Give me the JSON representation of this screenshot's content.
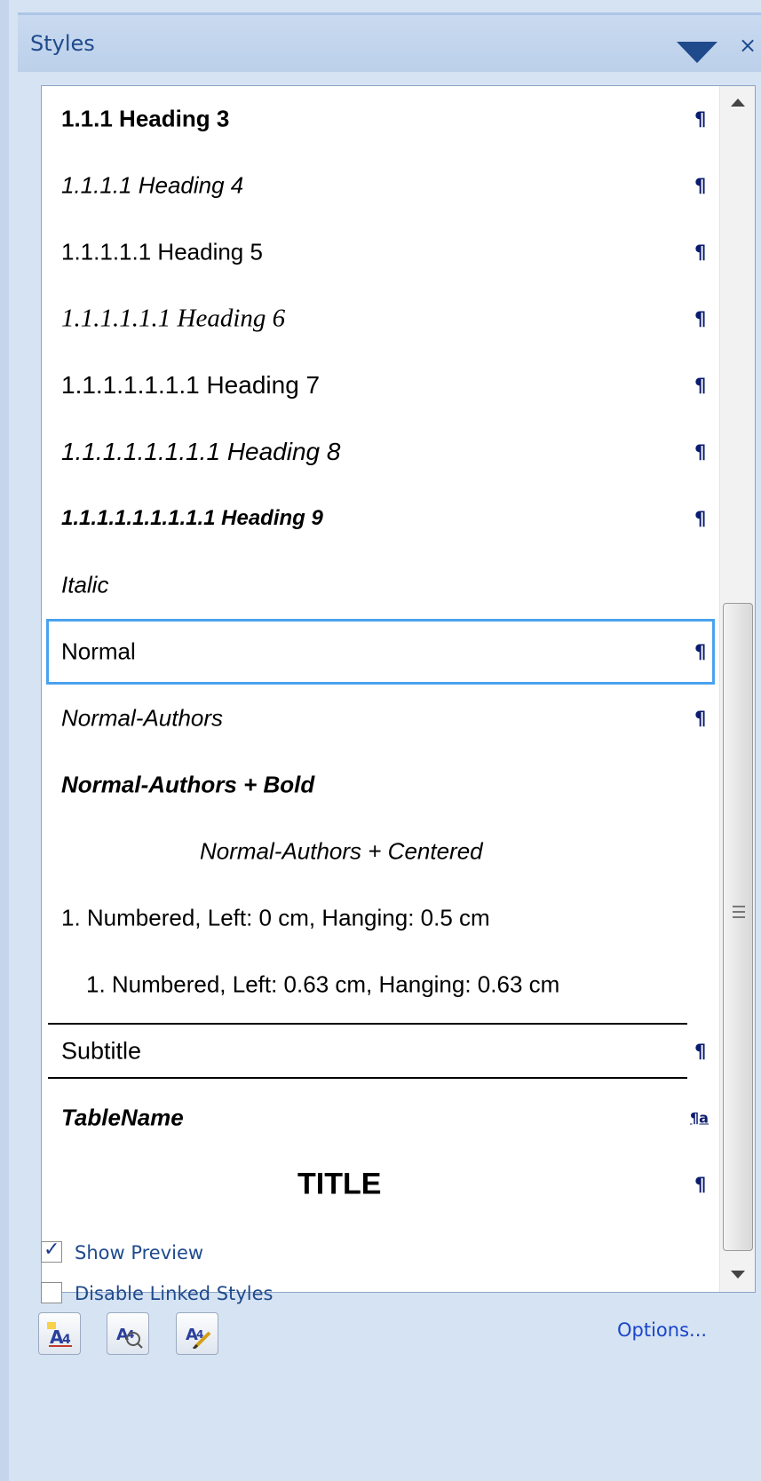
{
  "pane": {
    "title": "Styles",
    "dropdown_icon": "triangle-down-icon",
    "close_label": "×"
  },
  "styles": [
    {
      "label": "1.1.1  Heading 3",
      "mark": "¶",
      "selected": false
    },
    {
      "label": "1.1.1.1  Heading 4",
      "mark": "¶",
      "selected": false
    },
    {
      "label": "1.1.1.1.1  Heading 5",
      "mark": "¶",
      "selected": false
    },
    {
      "label": "1.1.1.1.1.1  Heading 6",
      "mark": "¶",
      "selected": false
    },
    {
      "label": "1.1.1.1.1.1.1  Heading 7",
      "mark": "¶",
      "selected": false
    },
    {
      "label": "1.1.1.1.1.1.1.1  Heading 8",
      "mark": "¶",
      "selected": false
    },
    {
      "label": "1.1.1.1.1.1.1.1.1  Heading 9",
      "mark": "¶",
      "selected": false
    },
    {
      "label": "Italic",
      "mark": "",
      "selected": false
    },
    {
      "label": "Normal",
      "mark": "¶",
      "selected": true
    },
    {
      "label": "Normal-Authors",
      "mark": "¶",
      "selected": false
    },
    {
      "label": "Normal-Authors + Bold",
      "mark": "",
      "selected": false
    },
    {
      "label": "Normal-Authors + Centered",
      "mark": "",
      "selected": false
    },
    {
      "label": "1.  Numbered, Left:  0 cm, Hanging:  0.5 cm",
      "mark": "",
      "selected": false
    },
    {
      "label": "1.  Numbered, Left:  0.63 cm, Hanging:  0.63 cm",
      "mark": "",
      "selected": false
    },
    {
      "label": "Subtitle",
      "mark": "¶",
      "selected": false
    },
    {
      "label": "TableName",
      "mark": "¶a",
      "selected": false
    },
    {
      "label": "TITLE",
      "mark": "¶",
      "selected": false
    }
  ],
  "scrollbar": {
    "up_icon": "scroll-up-arrow-icon",
    "down_icon": "scroll-down-arrow-icon",
    "grip_icon": "scroll-grip-icon"
  },
  "options": {
    "show_preview": {
      "label": "Show Preview",
      "checked": true
    },
    "disable_linked": {
      "label": "Disable Linked Styles",
      "checked": false
    }
  },
  "toolbar": {
    "buttons": [
      {
        "icon": "new-style-icon"
      },
      {
        "icon": "style-inspector-icon"
      },
      {
        "icon": "manage-styles-icon"
      }
    ],
    "options_label": "Options..."
  },
  "colors": {
    "pane_background": "#d6e3f3",
    "title_text": "#1f4a8c",
    "selection_border": "#4aa2ee",
    "link": "#1a46c8"
  }
}
